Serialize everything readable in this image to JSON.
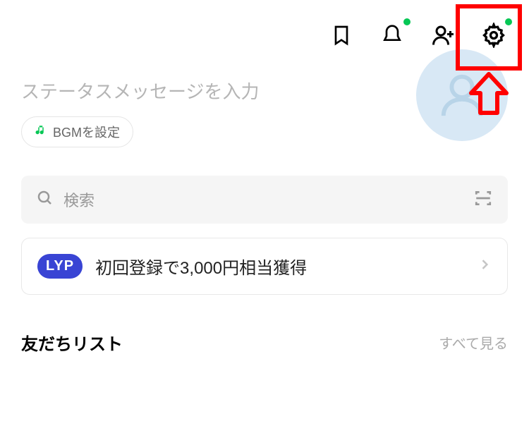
{
  "header": {
    "icons": {
      "bookmark": "bookmark-icon",
      "bell": "bell-icon",
      "addFriend": "add-friend-icon",
      "settings": "gear-icon"
    }
  },
  "profile": {
    "statusPlaceholder": "ステータスメッセージを入力",
    "bgmLabel": "BGMを設定"
  },
  "search": {
    "placeholder": "検索"
  },
  "promo": {
    "badge": "LYP",
    "text": "初回登録で3,000円相当獲得"
  },
  "friendList": {
    "title": "友だちリスト",
    "seeAll": "すべて見る"
  }
}
